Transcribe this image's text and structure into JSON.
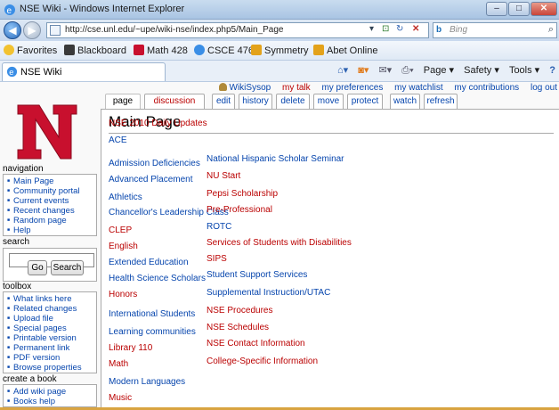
{
  "window": {
    "title": "NSE Wiki - Windows Internet Explorer"
  },
  "address": {
    "url": "http://cse.unl.edu/~upe/wiki-nse/index.php5/Main_Page",
    "search_placeholder": "Bing"
  },
  "favorites": {
    "label": "Favorites",
    "items": [
      "Blackboard",
      "Math 428",
      "CSCE 476",
      "Symmetry",
      "Abet Online"
    ]
  },
  "tab": {
    "title": "NSE Wiki"
  },
  "commandbar": {
    "page": "Page ▾",
    "safety": "Safety ▾",
    "tools": "Tools ▾"
  },
  "personal": {
    "user": "WikiSysop",
    "items": [
      "my talk",
      "my preferences",
      "my watchlist",
      "my contributions",
      "log out"
    ]
  },
  "ptabs": [
    "page",
    "discussion",
    "edit",
    "history",
    "delete",
    "move",
    "protect",
    "watch",
    "refresh"
  ],
  "page_title": "Main Page",
  "left_links": [
    {
      "text": "NSE 2010 Daily Updates",
      "color": "red"
    },
    {
      "text": "ACE",
      "color": "blue"
    },
    {
      "text": "Admission Deficiencies",
      "color": "blue"
    },
    {
      "text": "Advanced Placement",
      "color": "blue"
    },
    {
      "text": "Athletics",
      "color": "blue"
    },
    {
      "text": "Chancellor's Leadership Class",
      "color": "blue"
    },
    {
      "text": "CLEP",
      "color": "red"
    },
    {
      "text": "English",
      "color": "red"
    },
    {
      "text": "Extended Education",
      "color": "blue"
    },
    {
      "text": "Health Science Scholars",
      "color": "blue"
    },
    {
      "text": "Honors",
      "color": "red"
    },
    {
      "text": "International Students",
      "color": "blue"
    },
    {
      "text": "Learning communities",
      "color": "blue"
    },
    {
      "text": "Library 110",
      "color": "red"
    },
    {
      "text": "Math",
      "color": "red"
    },
    {
      "text": "Modern Languages",
      "color": "blue"
    },
    {
      "text": "Music",
      "color": "red"
    }
  ],
  "right_links": [
    {
      "text": "National Hispanic Scholar Seminar",
      "color": "blue"
    },
    {
      "text": "NU Start",
      "color": "red"
    },
    {
      "text": "Pepsi Scholarship",
      "color": "red"
    },
    {
      "text": "Pre-Professional",
      "color": "red"
    },
    {
      "text": "ROTC",
      "color": "blue"
    },
    {
      "text": "Services of Students with Disabilities",
      "color": "red"
    },
    {
      "text": "SIPS",
      "color": "red"
    },
    {
      "text": "Student Support Services",
      "color": "blue"
    },
    {
      "text": "Supplemental Instruction/UTAC",
      "color": "blue"
    },
    {
      "text": "NSE Procedures",
      "color": "red"
    },
    {
      "text": "NSE Schedules",
      "color": "red"
    },
    {
      "text": "NSE Contact Information",
      "color": "red"
    },
    {
      "text": "College-Specific Information",
      "color": "red"
    }
  ],
  "sidebar": {
    "navigation": {
      "title": "navigation",
      "items": [
        "Main Page",
        "Community portal",
        "Current events",
        "Recent changes",
        "Random page",
        "Help"
      ]
    },
    "search": {
      "title": "search",
      "go": "Go",
      "search": "Search"
    },
    "toolbox": {
      "title": "toolbox",
      "items": [
        "What links here",
        "Related changes",
        "Upload file",
        "Special pages",
        "Printable version",
        "Permanent link",
        "PDF version",
        "Browse properties"
      ]
    },
    "book": {
      "title": "create a book",
      "items": [
        "Add wiki page",
        "Books help"
      ]
    }
  },
  "colors": {
    "link": "#0645ad",
    "redlink": "#ba0000",
    "logo": "#c8102e"
  }
}
